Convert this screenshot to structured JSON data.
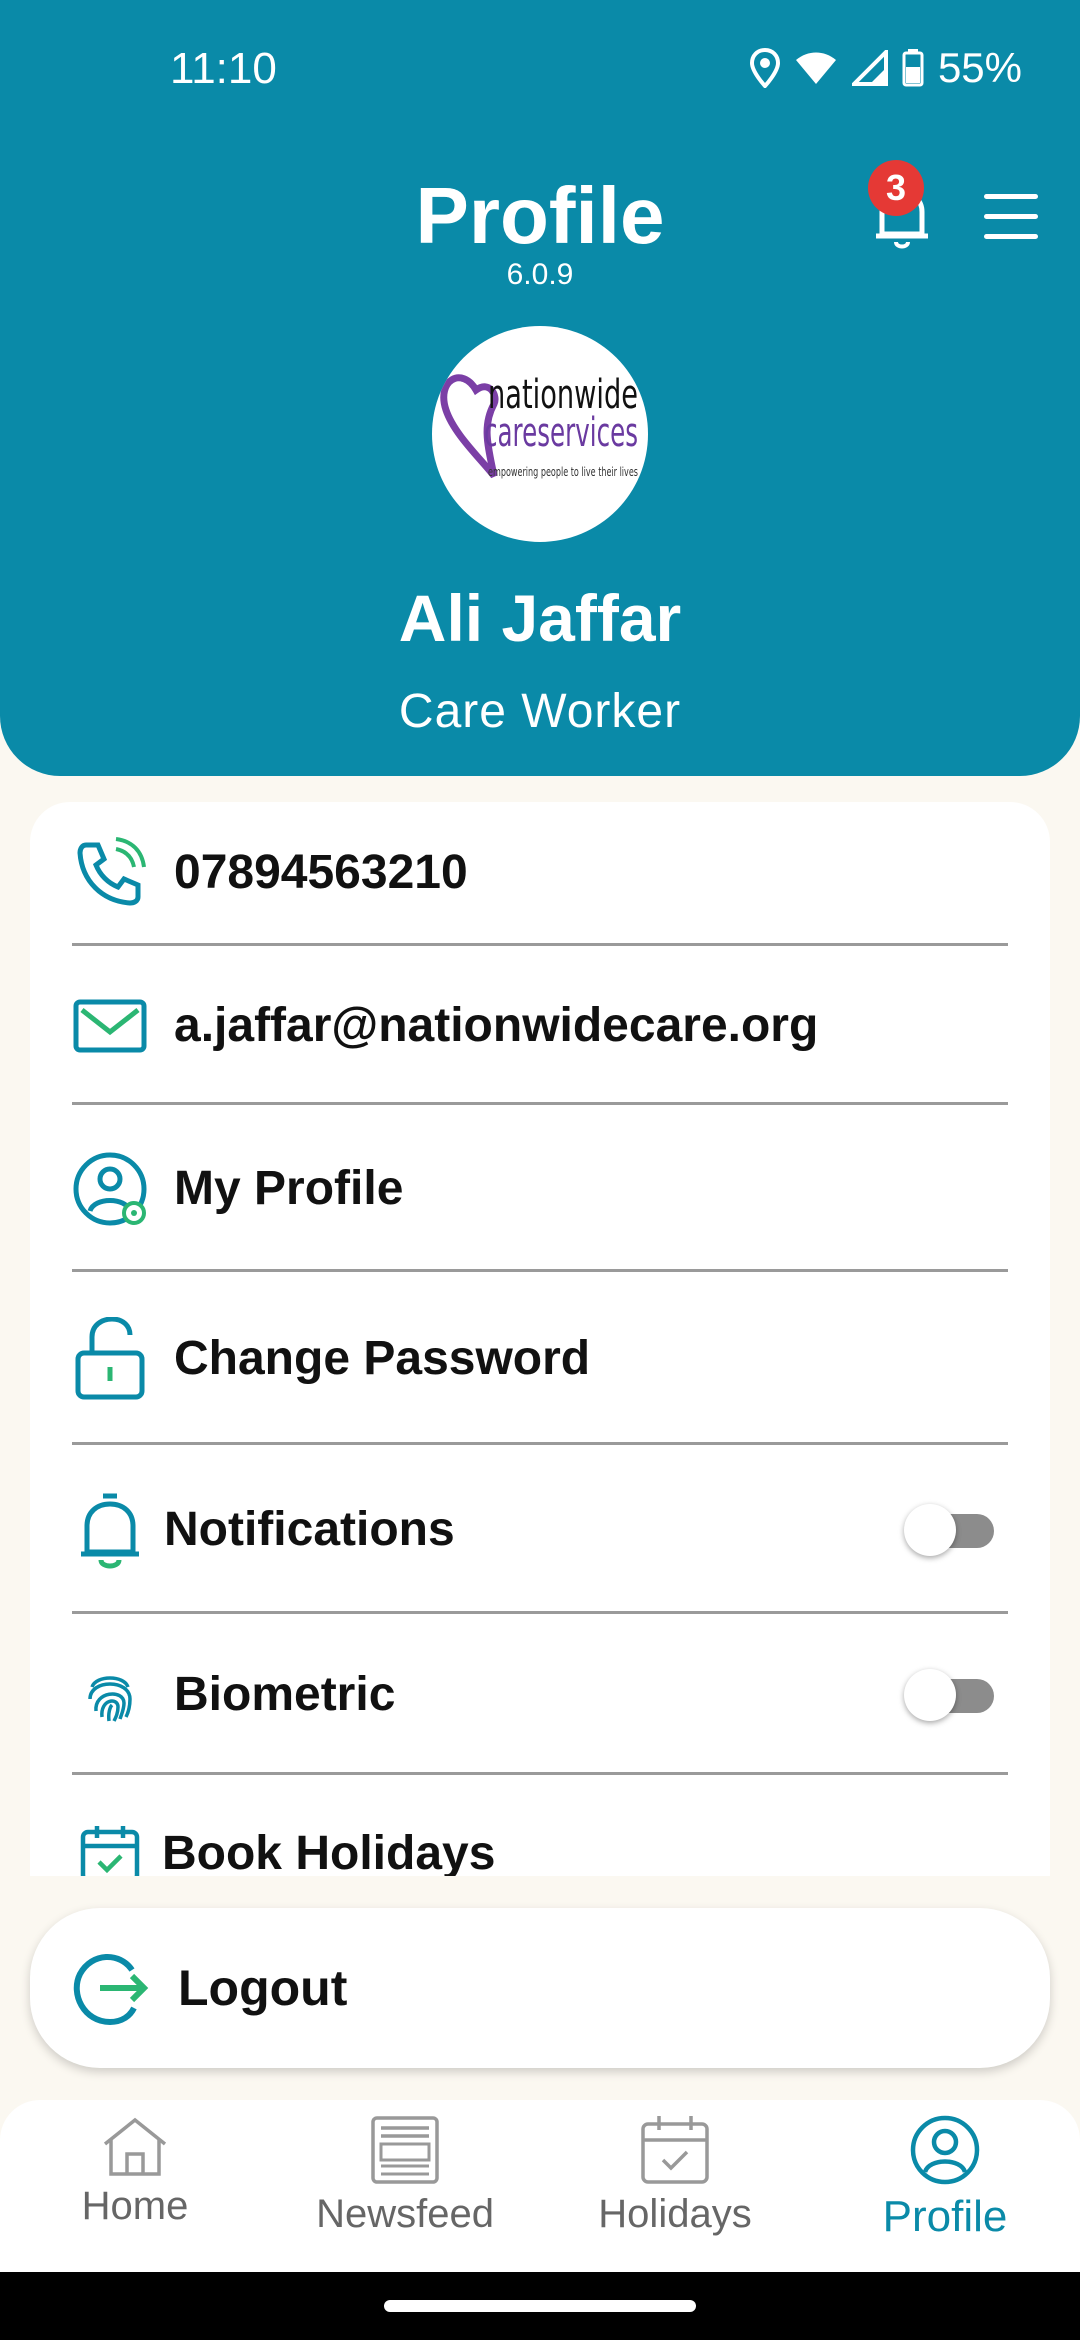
{
  "status": {
    "time": "11:10",
    "battery": "55%"
  },
  "header": {
    "title": "Profile",
    "version": "6.0.9",
    "notification_count": "3",
    "logo": {
      "line1": "nationwide",
      "line2": "careservices",
      "tagline": "empowering people to live their lives"
    },
    "user_name": "Ali Jaffar",
    "user_role": "Care Worker"
  },
  "menu": {
    "phone": "07894563210",
    "email": "a.jaffar@nationwidecare.org",
    "my_profile": "My Profile",
    "change_password": "Change Password",
    "notifications": "Notifications",
    "biometric": "Biometric",
    "book_holidays": "Book Holidays"
  },
  "toggles": {
    "notifications_on": false,
    "biometric_on": false
  },
  "logout": {
    "label": "Logout"
  },
  "nav": {
    "items": [
      {
        "label": "Home"
      },
      {
        "label": "Newsfeed"
      },
      {
        "label": "Holidays"
      },
      {
        "label": "Profile"
      }
    ],
    "active": "Profile"
  },
  "colors": {
    "primary": "#0a8aa8",
    "accent_green": "#2bb673",
    "badge": "#e53935",
    "background": "#fbf8f1"
  }
}
